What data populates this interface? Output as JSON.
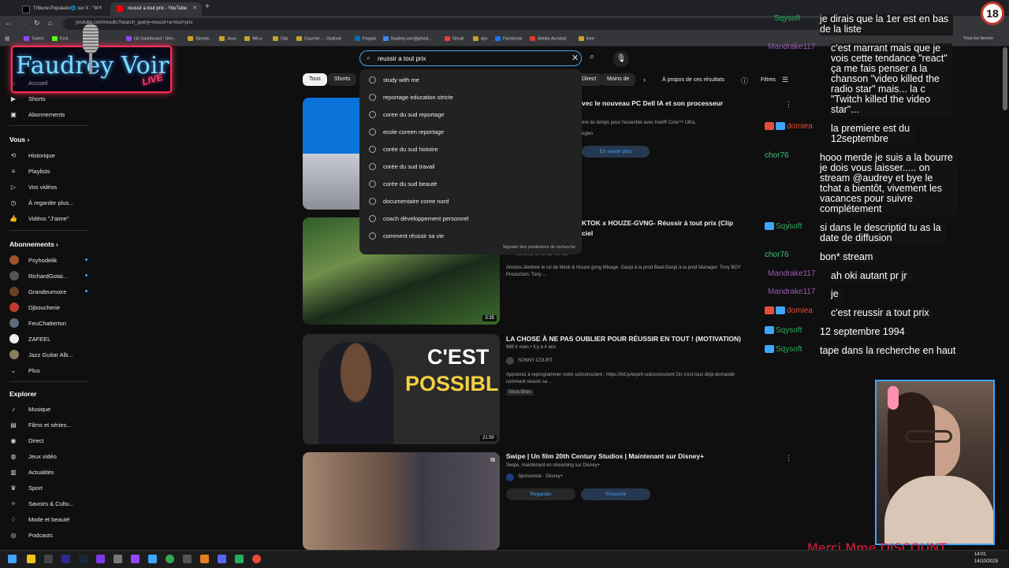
{
  "browser": {
    "tabs": [
      {
        "label": "Tribune Populaire🌐 sur X : \"M",
        "active": false
      },
      {
        "label": "reussir a tout prix - YouTube",
        "active": true
      }
    ],
    "new_tab": "+",
    "url": "youtube.com/results?search_query=reussir+a+tout+prix",
    "bookmarks": [
      "Twitch",
      "Kick",
      "(4) Dashboard / Stre...",
      "Stream",
      "Jeux",
      "Wii-u",
      "Clip",
      "Courrier - - Outlook",
      "Paypal",
      "faudrey.voir@gmail...",
      "Gmail",
      "dys",
      "Facebook",
      "Adobe Acrobat",
      "livre"
    ],
    "all_bookmarks": "Tous les favoris"
  },
  "overlay": {
    "logo_line1": "Faudrey Voir",
    "logo_line2": "LIVE",
    "age_badge": "18",
    "ticker": "Merci Mme DISCOUNT...."
  },
  "sidebar": {
    "main": [
      {
        "label": "Accueil",
        "icon": "home-icon"
      },
      {
        "label": "Shorts",
        "icon": "shorts-icon"
      },
      {
        "label": "Abonnements",
        "icon": "subscriptions-icon"
      }
    ],
    "you_header": "Vous",
    "you": [
      {
        "label": "Historique",
        "icon": "history-icon"
      },
      {
        "label": "Playlists",
        "icon": "playlist-icon"
      },
      {
        "label": "Vos vidéos",
        "icon": "your-videos-icon"
      },
      {
        "label": "À regarder plus...",
        "icon": "watch-later-icon"
      },
      {
        "label": "Vidéos \"J'aime\"",
        "icon": "like-icon"
      }
    ],
    "subs_header": "Abonnements",
    "subs": [
      {
        "label": "Psyhodelik",
        "color": "#a0522d",
        "dot": true
      },
      {
        "label": "RichardGotai...",
        "color": "#444444",
        "dot": true
      },
      {
        "label": "Grandeurnoire",
        "color": "#6b3e26",
        "dot": true
      },
      {
        "label": "Djboucherie",
        "color": "#c0392b",
        "dot": false
      },
      {
        "label": "FeuChatterton",
        "color": "#5d6d7e",
        "dot": false
      },
      {
        "label": "ZAFEEL",
        "color": "#ffffff",
        "dot": false
      },
      {
        "label": "Jazz Guitar Alb...",
        "color": "#8e7d5a",
        "dot": false
      }
    ],
    "more": "Plus",
    "explore_header": "Explorer",
    "explore": [
      {
        "label": "Musique",
        "icon": "music-icon"
      },
      {
        "label": "Films et séries...",
        "icon": "movies-icon"
      },
      {
        "label": "Direct",
        "icon": "live-icon"
      },
      {
        "label": "Jeux vidéo",
        "icon": "gaming-icon"
      },
      {
        "label": "Actualités",
        "icon": "news-icon"
      },
      {
        "label": "Sport",
        "icon": "sport-icon"
      },
      {
        "label": "Savoirs & Cultu...",
        "icon": "learning-icon"
      },
      {
        "label": "Mode et beauté",
        "icon": "fashion-icon"
      },
      {
        "label": "Podcasts",
        "icon": "podcast-icon"
      }
    ]
  },
  "search": {
    "query": "reussir a tout prix",
    "suggestions": [
      "study with me",
      "reportage education stricte",
      "coree du sud reportage",
      "ecole coreen reportage",
      "corée du sud histoire",
      "corée du sud travail",
      "corée du sud beauté",
      "documentaire coree nord",
      "coach développement personnel",
      "comment réussir sa vie"
    ],
    "report_link": "Signaler des prédictions de recherche"
  },
  "filters": {
    "chips": [
      "Tous",
      "Shorts",
      "Direct",
      "Moins de"
    ],
    "about": "À propos de ces résultats",
    "filters_label": "Filtres"
  },
  "videos": [
    {
      "title": "vec le nouveau PC Dell IA et son processeur",
      "desc": "ère du temps pour l'essentiel avec Intel® Core™ Ultra.",
      "sub": "ogies",
      "button": "En savoir plus"
    },
    {
      "title": "KTOK x HOUZE-GVNG- Réussir à tout prix (Clip",
      "title2": "ciel",
      "channel": "Jérémie le roi de Tik Tok",
      "desc": "Artistes:Jérémie le roi de tiktok & Houze gvng Mixage: Gaspi à la prod Beat:Gaspi à la prod Manager: Tony BOY",
      "desc2": "Production: Tony ...",
      "duration": "3:35"
    },
    {
      "title": "LA CHOSE À NE PAS OUBLIER POUR RÉUSSIR EN TOUT ! (MOTIVATION)",
      "views": "988 k vues • il y a 4 ans",
      "channel": "SONNY COURT",
      "desc": "Apprenez à reprogrammer votre subconscient : https://bit.ly/esprit-subsconscient On s'est tous déjà demandé",
      "desc2": "comment réussir sa ...",
      "badge": "Sous-titres",
      "thumb_text1": "C'EST",
      "thumb_text2": "POSSIBLE",
      "duration": "21:50"
    },
    {
      "title": "Swipe | Un film 20th Century Studios | Maintenant sur Disney+",
      "desc": "Swipe, maintenant en streaming sur Disney+",
      "sponsor": "Sponsorisé · Disney+",
      "btn1": "Regarder",
      "btn2": "S'inscrire"
    }
  ],
  "chat": [
    {
      "name": "Sqysoft",
      "color": "#27ae60",
      "msg": "je dirais que la 1er est en bas\nde la liste"
    },
    {
      "name": "Mandrake117",
      "color": "#9b59b6",
      "msg": "c'est marrant mais que je\nvois cette tendance \"react\"\nça me fais penser a la\nchanson \"video killed the\nradio star\" mais... la c\n\"Twitch killed the video\nstar\"..."
    },
    {
      "name": "domiea",
      "color": "#e74c3c",
      "msg": "la premiere est du\n12septembre"
    },
    {
      "name": "chor76",
      "color": "#2ecc71",
      "msg": "hooo merde je suis a la bourre\nje dois vous laisser..... on\nstream @audrey et bye le\ntchat a bientôt, vivement les\nvacances pour suivre\ncomplétement"
    },
    {
      "name": "Sqysoft",
      "color": "#27ae60",
      "msg": "si dans le descriptid tu as la\ndate de diffusion"
    },
    {
      "name": "chor76",
      "color": "#2ecc71",
      "msg": "bon* stream"
    },
    {
      "name": "Mandrake117",
      "color": "#9b59b6",
      "msg": "ah oki autant pr jr"
    },
    {
      "name": "Mandrake117",
      "color": "#9b59b6",
      "msg": "je"
    },
    {
      "name": "domiea",
      "color": "#e74c3c",
      "msg": "c'est reussir a tout prix"
    },
    {
      "name": "Sqysoft",
      "color": "#27ae60",
      "msg": "12 septembre 1994"
    },
    {
      "name": "Sqysoft",
      "color": "#27ae60",
      "msg": "tape dans la recherche en haut"
    }
  ],
  "taskbar": {
    "time": "14:01",
    "date": "14/10/2025"
  }
}
